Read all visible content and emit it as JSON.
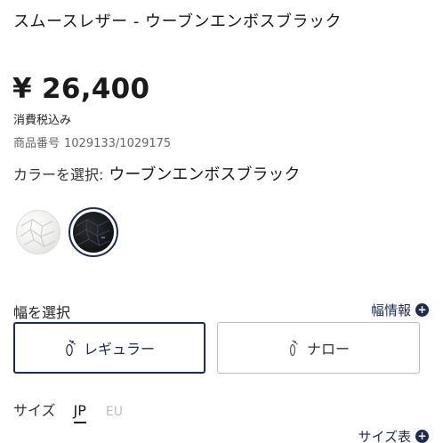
{
  "product": {
    "title": "スムースレザー - ウーブンエンボスブラック",
    "price": "¥ 26,400",
    "tax_note": "消費税込み",
    "product_number_label": "商品番号",
    "product_number": "1029133/1029175"
  },
  "color": {
    "label": "カラーを選択:",
    "selected": "ウーブンエンボスブラック",
    "swatches": [
      {
        "name": "white",
        "color": "#eeeeec",
        "selected": false
      },
      {
        "name": "black",
        "color": "#121316",
        "selected": true
      }
    ]
  },
  "width": {
    "label": "幅を選択",
    "help_link": "幅情報",
    "options": [
      {
        "label": "レギュラー",
        "icon": "foot-icon",
        "selected": true
      },
      {
        "label": "ナロー",
        "icon": "foot-icon",
        "selected": false
      }
    ]
  },
  "size": {
    "label": "サイズ",
    "units": [
      {
        "label": "JP",
        "selected": true
      },
      {
        "label": "EU",
        "selected": false
      }
    ],
    "help_link": "サイズ表"
  },
  "colors": {
    "accent": "#1c2a56",
    "muted": "#bdbdbd"
  }
}
